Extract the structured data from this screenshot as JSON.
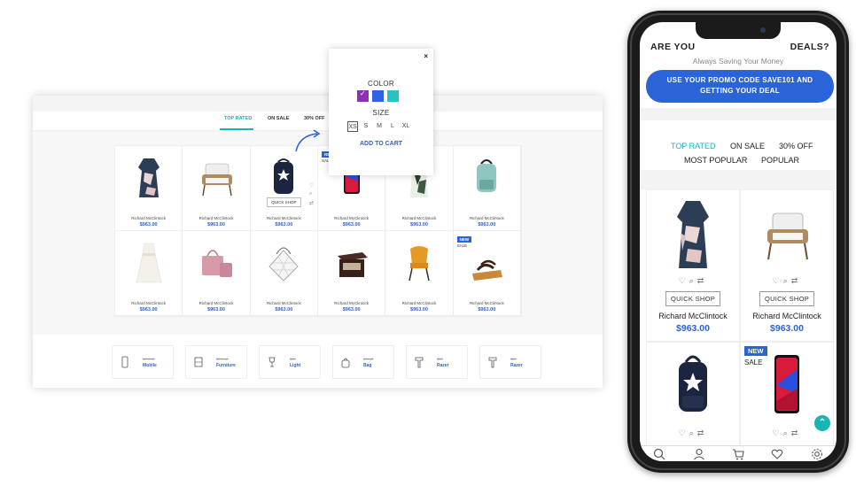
{
  "desktop": {
    "tabs": [
      {
        "label": "TOP RATED",
        "active": true
      },
      {
        "label": "ON SALE",
        "active": false
      },
      {
        "label": "30% OFF",
        "active": false
      }
    ],
    "products": [
      {
        "name": "Richard McClintock",
        "price": "$963.00",
        "icon": "dress"
      },
      {
        "name": "Richard McClintock",
        "price": "$963.00",
        "icon": "armchair"
      },
      {
        "name": "Richard McClintock",
        "price": "$963.00",
        "icon": "backpack",
        "quick_shop": "QUICK SHOP"
      },
      {
        "name": "Richard McClintock",
        "price": "$963.00",
        "icon": "smartphone",
        "badge": "NEW",
        "sale": "SALE"
      },
      {
        "name": "Richard McClintock",
        "price": "$963.00",
        "icon": "dress"
      },
      {
        "name": "Richard McClintock",
        "price": "$963.00",
        "icon": "backpack"
      },
      {
        "name": "Richard McClintock",
        "price": "$963.00",
        "icon": "white-dress"
      },
      {
        "name": "Richard McClintock",
        "price": "$963.00",
        "icon": "handbag"
      },
      {
        "name": "Richard McClintock",
        "price": "$963.00",
        "icon": "tote-bag"
      },
      {
        "name": "Richard McClintock",
        "price": "$963.00",
        "icon": "side-table"
      },
      {
        "name": "Richard McClintock",
        "price": "$963.00",
        "icon": "chair"
      },
      {
        "name": "Richard McClintock",
        "price": "$963.00",
        "icon": "sandal",
        "badge": "NEW",
        "sale": "SALE"
      }
    ],
    "categories": [
      {
        "off": "10% off",
        "name": "Mobile",
        "icon": "mobile-icon"
      },
      {
        "off": "30% off",
        "name": "Furniture",
        "icon": "furniture-icon"
      },
      {
        "off": "$99",
        "name": "Light",
        "icon": "light-icon"
      },
      {
        "off": "0% off",
        "name": "Bag",
        "icon": "bag-icon"
      },
      {
        "off": "$99",
        "name": "Razer",
        "icon": "razer-icon"
      },
      {
        "off": "$99",
        "name": "Razer",
        "icon": "razer-icon"
      }
    ]
  },
  "popup": {
    "close": "×",
    "color_label": "COLOR",
    "colors": [
      "#8e2fb7",
      "#2f62e6",
      "#29c2c2"
    ],
    "size_label": "SIZE",
    "sizes": [
      "XS",
      "S",
      "M",
      "L",
      "XL"
    ],
    "add_to_cart": "ADD TO CART"
  },
  "phone": {
    "heading_left": "ARE YOU",
    "heading_right": "DEALS?",
    "subheading": "Always Saving Your Money",
    "promo_line1_pre": "USE YOUR PROMO CODE ",
    "promo_code": "SAVE101",
    "promo_line1_post": " AND",
    "promo_line2": "GETTING YOUR DEAL",
    "tabs": [
      "TOP RATED",
      "ON SALE",
      "30% OFF",
      "MOST POPULAR",
      "POPULAR"
    ],
    "products": [
      {
        "name": "Richard McClintock",
        "price": "$963.00",
        "quick_shop": "QUICK SHOP",
        "icon": "dress"
      },
      {
        "name": "Richard McClintock",
        "price": "$963.00",
        "quick_shop": "QUICK SHOP",
        "icon": "armchair"
      },
      {
        "icon": "backpack"
      },
      {
        "icon": "smartphone",
        "badge": "NEW",
        "sale": "SALE"
      }
    ],
    "fab_icon": "scroll-top-icon",
    "bottom_nav": [
      "search-icon",
      "user-icon",
      "cart-icon",
      "heart-icon",
      "settings-icon"
    ]
  },
  "colors": {
    "accent": "#2b63d9",
    "teal": "#19b5b5"
  }
}
